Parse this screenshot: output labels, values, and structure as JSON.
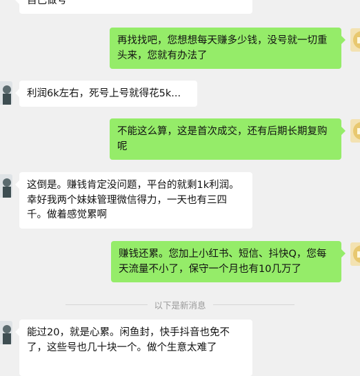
{
  "messages": [
    {
      "side": "left",
      "text": "自己做号"
    },
    {
      "side": "right",
      "text": "再找找吧，您想想每天赚多少钱，没号就一切重头来，您就有办法了"
    },
    {
      "side": "left",
      "text": "利润6k左右，死号上号就得花5k..."
    },
    {
      "side": "right",
      "text": "不能这么算，这是首次成交，还有后期长期复购呢"
    },
    {
      "side": "left",
      "text": "这倒是。赚钱肯定没问题，平台的就剩1k利润。幸好我两个妹妹管理微信得力，一天也有三四千。做着感觉累啊"
    },
    {
      "side": "right",
      "text": "赚钱还累。您加上小红书、短信、抖快Q，您每天流量不小了，保守一个月也有10几万了"
    },
    {
      "side": "left",
      "text": "能过20，就是心累。闲鱼封，快手抖音也免不了，这些号也几十块一个。做个生意太难了"
    }
  ],
  "divider": {
    "label": "以下是新消息"
  },
  "colors": {
    "background": "#f0f0f0",
    "self_bubble": "#95ec69",
    "other_bubble": "#ffffff"
  },
  "icons": {
    "other_avatar": "person-avatar-icon",
    "self_avatar": "yellow-logo-avatar-icon"
  }
}
